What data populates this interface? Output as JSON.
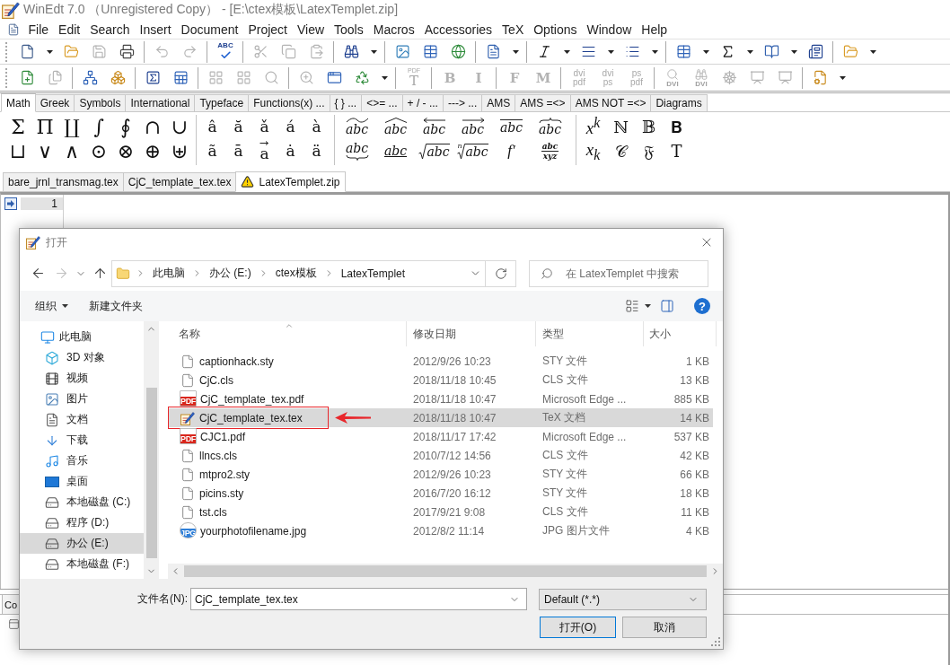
{
  "window": {
    "title": "WinEdt 7.0 （Unregistered Copy） - [E:\\ctex模板\\LatexTemplet.zip]"
  },
  "menu": [
    "File",
    "Edit",
    "Search",
    "Insert",
    "Document",
    "Project",
    "View",
    "Tools",
    "Macros",
    "Accessories",
    "TeX",
    "Options",
    "Window",
    "Help"
  ],
  "toolbars": [
    [
      {
        "kind": "new",
        "disabled": false
      },
      {
        "kind": "caret",
        "disabled": false
      },
      {
        "kind": "open",
        "disabled": false
      },
      {
        "kind": "save",
        "disabled": true
      },
      {
        "kind": "print",
        "disabled": false
      },
      {
        "kind": "separator"
      },
      {
        "kind": "undo",
        "disabled": true
      },
      {
        "kind": "redo",
        "disabled": true
      },
      {
        "kind": "separator"
      },
      {
        "kind": "spell",
        "label": "ABC",
        "disabled": false
      },
      {
        "kind": "separator"
      },
      {
        "kind": "cut",
        "disabled": true
      },
      {
        "kind": "copy",
        "disabled": true
      },
      {
        "kind": "paste",
        "disabled": true
      },
      {
        "kind": "separator"
      },
      {
        "kind": "find",
        "disabled": false
      },
      {
        "kind": "caret",
        "disabled": false
      },
      {
        "kind": "separator"
      },
      {
        "kind": "image",
        "disabled": false
      },
      {
        "kind": "table",
        "disabled": false
      },
      {
        "kind": "web",
        "disabled": false
      },
      {
        "kind": "separator"
      },
      {
        "kind": "document",
        "disabled": false
      },
      {
        "kind": "caret",
        "disabled": false
      },
      {
        "kind": "separator"
      },
      {
        "kind": "italic",
        "disabled": false
      },
      {
        "kind": "caret",
        "disabled": false
      },
      {
        "kind": "align",
        "disabled": false
      },
      {
        "kind": "caret",
        "disabled": false
      },
      {
        "kind": "list",
        "disabled": false
      },
      {
        "kind": "caret",
        "disabled": false
      },
      {
        "kind": "separator"
      },
      {
        "kind": "grid",
        "disabled": false
      },
      {
        "kind": "caret",
        "disabled": false
      },
      {
        "kind": "sigma",
        "disabled": false
      },
      {
        "kind": "caret",
        "disabled": false
      },
      {
        "kind": "book",
        "disabled": false
      },
      {
        "kind": "caret",
        "disabled": false
      },
      {
        "kind": "textbox",
        "disabled": false
      },
      {
        "kind": "separator"
      },
      {
        "kind": "folder",
        "disabled": false
      },
      {
        "kind": "caret",
        "disabled": false
      }
    ],
    [
      {
        "kind": "addfile",
        "disabled": false
      },
      {
        "kind": "page",
        "disabled": true
      },
      {
        "kind": "separator"
      },
      {
        "kind": "tree",
        "disabled": false
      },
      {
        "kind": "boxes",
        "disabled": false
      },
      {
        "kind": "separator"
      },
      {
        "kind": "sigmasheet",
        "disabled": false
      },
      {
        "kind": "sheet",
        "disabled": false
      },
      {
        "kind": "separator"
      },
      {
        "kind": "blocks",
        "disabled": true
      },
      {
        "kind": "blocks",
        "disabled": true
      },
      {
        "kind": "zoom",
        "disabled": true
      },
      {
        "kind": "separator"
      },
      {
        "kind": "inspect",
        "disabled": true
      },
      {
        "kind": "window",
        "disabled": false
      },
      {
        "kind": "recycle",
        "disabled": false
      },
      {
        "kind": "caret",
        "disabled": false
      },
      {
        "kind": "separator"
      },
      {
        "kind": "texify",
        "top": "PDF",
        "bottom": "T",
        "disabled": true
      },
      {
        "kind": "separator"
      },
      {
        "kind": "letter",
        "label": "B",
        "disabled": true
      },
      {
        "kind": "letter",
        "label": "I",
        "disabled": true
      },
      {
        "kind": "separator"
      },
      {
        "kind": "letter",
        "label": "F",
        "disabled": true
      },
      {
        "kind": "letter",
        "label": "M",
        "disabled": true
      },
      {
        "kind": "separator"
      },
      {
        "kind": "stack",
        "top": "dvi",
        "bottom": "pdf",
        "disabled": true
      },
      {
        "kind": "stack",
        "top": "dvi",
        "bottom": "ps",
        "disabled": true
      },
      {
        "kind": "stack",
        "top": "ps",
        "bottom": "pdf",
        "disabled": true
      },
      {
        "kind": "separator"
      },
      {
        "kind": "dviview",
        "label": "DVI",
        "disabled": true
      },
      {
        "kind": "dvifind",
        "label": "DVI",
        "disabled": true
      },
      {
        "kind": "wheel",
        "disabled": true
      },
      {
        "kind": "reader",
        "disabled": true
      },
      {
        "kind": "reader",
        "disabled": true
      },
      {
        "kind": "separator"
      },
      {
        "kind": "settings",
        "disabled": false
      },
      {
        "kind": "caret",
        "disabled": false
      }
    ]
  ],
  "palette": {
    "tabs": [
      {
        "label": "Math",
        "selected": true
      },
      {
        "label": "Greek",
        "selected": false
      },
      {
        "label": "Symbols",
        "selected": false
      },
      {
        "label": "International",
        "selected": false
      },
      {
        "label": "Typeface",
        "selected": false
      },
      {
        "label": "Functions(x) ...",
        "selected": false
      },
      {
        "label": "{ } ...",
        "selected": false
      },
      {
        "label": "<>= ...",
        "selected": false
      },
      {
        "label": "+ / - ...",
        "selected": false
      },
      {
        "label": "---> ...",
        "selected": false
      },
      {
        "label": "AMS",
        "selected": false
      },
      {
        "label": "AMS =<>",
        "selected": false
      },
      {
        "label": "AMS NOT =<>",
        "selected": false
      },
      {
        "label": "Diagrams",
        "selected": false
      }
    ],
    "groups": [
      {
        "kind": "operators",
        "rows": [
          [
            "Σ",
            "Π",
            "∐",
            "∫",
            "∮",
            "∩",
            "∪"
          ],
          [
            "⊔",
            "∨",
            "∧",
            "⊙",
            "⊗",
            "⊕",
            "⊎"
          ]
        ]
      },
      {
        "kind": "accents",
        "rows": [
          [
            {
              "kind": "plain",
              "text": "â"
            },
            {
              "kind": "plain",
              "text": "ă"
            },
            {
              "kind": "plain",
              "text": "ǎ"
            },
            {
              "kind": "plain",
              "text": "á"
            },
            {
              "kind": "plain",
              "text": "à"
            }
          ],
          [
            {
              "kind": "plain",
              "text": "ã"
            },
            {
              "kind": "plain",
              "text": "ā"
            },
            {
              "kind": "vector",
              "text": "a"
            },
            {
              "kind": "plain",
              "text": "ȧ"
            },
            {
              "kind": "plain",
              "text": "ä"
            }
          ]
        ]
      },
      {
        "kind": "decorated",
        "rows": [
          [
            {
              "kind": "widetilde",
              "text": "abc"
            },
            {
              "kind": "widehat",
              "text": "abc"
            },
            {
              "kind": "leftarrow",
              "text": "abc"
            },
            {
              "kind": "rightarrow",
              "text": "abc"
            },
            {
              "kind": "overline",
              "text": "abc"
            },
            {
              "kind": "overbrace",
              "text": "abc"
            }
          ],
          [
            {
              "kind": "underbrace",
              "text": "abc"
            },
            {
              "kind": "underline",
              "text": "abc"
            },
            {
              "kind": "sqrt",
              "text": "abc"
            },
            {
              "kind": "root",
              "index": "n",
              "text": "abc"
            },
            {
              "kind": "plain",
              "text": "f′"
            },
            {
              "kind": "fraction",
              "text": "abc",
              "denominator": "xyz"
            }
          ]
        ]
      },
      {
        "kind": "fonts",
        "rows": [
          [
            {
              "kind": "math",
              "text": "x$^{k}$"
            },
            {
              "kind": "symbol",
              "text": "ℕ"
            },
            {
              "kind": "symbol",
              "text": "𝔹"
            },
            {
              "kind": "symbol",
              "text": "𝐁"
            }
          ],
          [
            {
              "kind": "math",
              "text": "x$_{k}$"
            },
            {
              "kind": "symbol",
              "text": "𝒞"
            },
            {
              "kind": "symbol",
              "text": "𝔉"
            },
            {
              "kind": "symbol",
              "text": "T"
            }
          ]
        ]
      }
    ]
  },
  "document_tabs": [
    {
      "label": "bare_jrnl_transmag.tex",
      "selected": false,
      "warning": false
    },
    {
      "label": "CjC_template_tex.tex",
      "selected": false,
      "warning": false
    },
    {
      "label": "LatexTemplet.zip",
      "selected": true,
      "warning": true
    }
  ],
  "editor": {
    "lines": [
      {
        "number": "1",
        "current": true
      }
    ]
  },
  "bottom_panel": {
    "tabs": [
      "Co"
    ]
  },
  "dialog": {
    "title": "打开",
    "nav_buttons": [
      {
        "kind": "back",
        "disabled": false
      },
      {
        "kind": "forward",
        "disabled": true
      },
      {
        "kind": "recent",
        "disabled": false
      },
      {
        "kind": "up",
        "disabled": false
      }
    ],
    "address": [
      "此电脑",
      "办公 (E:)",
      "ctex模板",
      "LatexTemplet"
    ],
    "search": {
      "placeholder": "在 LatexTemplet 中搜索"
    },
    "commands": [
      {
        "label": "组织",
        "dropdown": true
      },
      {
        "label": "新建文件夹",
        "dropdown": false
      }
    ],
    "help": "?",
    "nav_pane": [
      {
        "label": "此电脑",
        "kind": "computer",
        "selected": false,
        "children": [
          {
            "label": "3D 对象",
            "kind": "objects",
            "selected": false
          },
          {
            "label": "视频",
            "kind": "videos",
            "selected": false
          },
          {
            "label": "图片",
            "kind": "pictures",
            "selected": false
          },
          {
            "label": "文档",
            "kind": "documents",
            "selected": false
          },
          {
            "label": "下载",
            "kind": "downloads",
            "selected": false
          },
          {
            "label": "音乐",
            "kind": "music",
            "selected": false
          },
          {
            "label": "桌面",
            "kind": "desktop",
            "selected": false
          },
          {
            "label": "本地磁盘 (C:)",
            "kind": "systemdrive",
            "selected": false
          },
          {
            "label": "程序 (D:)",
            "kind": "drive",
            "selected": false
          },
          {
            "label": "办公 (E:)",
            "kind": "drive",
            "selected": true
          },
          {
            "label": "本地磁盘 (F:)",
            "kind": "drive",
            "selected": false
          }
        ]
      }
    ],
    "columns": [
      {
        "label": "名称",
        "sorted": true
      },
      {
        "label": "修改日期",
        "sorted": false
      },
      {
        "label": "类型",
        "sorted": false
      },
      {
        "label": "大小",
        "sorted": false
      }
    ],
    "files": [
      {
        "name": "captionhack.sty",
        "kind": "file",
        "date": "2012/9/26 10:23",
        "type": "STY 文件",
        "size": "1 KB",
        "selected": false,
        "marked": false
      },
      {
        "name": "CjC.cls",
        "kind": "file",
        "date": "2018/11/18 10:45",
        "type": "CLS 文件",
        "size": "13 KB",
        "selected": false,
        "marked": false
      },
      {
        "name": "CjC_template_tex.pdf",
        "kind": "pdf",
        "badge": "PDF",
        "date": "2018/11/18 10:47",
        "type": "Microsoft Edge ...",
        "size": "885 KB",
        "selected": false,
        "marked": false
      },
      {
        "name": "CjC_template_tex.tex",
        "kind": "tex",
        "date": "2018/11/18 10:47",
        "type": "TeX 文档",
        "size": "14 KB",
        "selected": true,
        "marked": true
      },
      {
        "name": "CJC1.pdf",
        "kind": "pdf",
        "badge": "PDF",
        "date": "2018/11/17 17:42",
        "type": "Microsoft Edge ...",
        "size": "537 KB",
        "selected": false,
        "marked": false
      },
      {
        "name": "llncs.cls",
        "kind": "file",
        "date": "2010/7/12 14:56",
        "type": "CLS 文件",
        "size": "42 KB",
        "selected": false,
        "marked": false
      },
      {
        "name": "mtpro2.sty",
        "kind": "file",
        "date": "2012/9/26 10:23",
        "type": "STY 文件",
        "size": "66 KB",
        "selected": false,
        "marked": false
      },
      {
        "name": "picins.sty",
        "kind": "file",
        "date": "2016/7/20 16:12",
        "type": "STY 文件",
        "size": "18 KB",
        "selected": false,
        "marked": false
      },
      {
        "name": "tst.cls",
        "kind": "file",
        "date": "2017/9/21 9:08",
        "type": "CLS 文件",
        "size": "11 KB",
        "selected": false,
        "marked": false
      },
      {
        "name": "yourphotofilename.jpg",
        "kind": "image",
        "badge": "JPG",
        "date": "2012/8/2 11:14",
        "type": "JPG 图片文件",
        "size": "4 KB",
        "selected": false,
        "marked": false
      }
    ],
    "filename": {
      "label": "文件名(N):",
      "value": "CjC_template_tex.tex"
    },
    "filetype": {
      "value": "Default (*.*)"
    },
    "buttons": [
      {
        "label": "打开(O)",
        "default": true
      },
      {
        "label": "取消",
        "default": false
      }
    ]
  }
}
